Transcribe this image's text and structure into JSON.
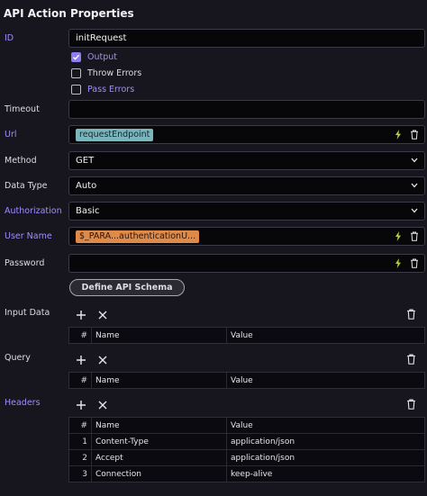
{
  "panel": {
    "title": "API Action Properties"
  },
  "id": {
    "label": "ID",
    "value": "initRequest"
  },
  "checkboxes": [
    {
      "label": "Output",
      "checked": true
    },
    {
      "label": "Throw Errors",
      "checked": false
    },
    {
      "label": "Pass Errors",
      "checked": false
    }
  ],
  "timeout": {
    "label": "Timeout",
    "value": ""
  },
  "url": {
    "label": "Url",
    "tag": "requestEndpoint"
  },
  "method": {
    "label": "Method",
    "value": "GET"
  },
  "data_type": {
    "label": "Data Type",
    "value": "Auto"
  },
  "authorization": {
    "label": "Authorization",
    "value": "Basic"
  },
  "user_name": {
    "label": "User Name",
    "tag": "$_PARA...authenticationU..."
  },
  "password": {
    "label": "Password",
    "value": ""
  },
  "define_schema": {
    "label": "Define API Schema"
  },
  "input_data": {
    "label": "Input Data",
    "columns": [
      "#",
      "Name",
      "Value"
    ],
    "rows": []
  },
  "query": {
    "label": "Query",
    "columns": [
      "#",
      "Name",
      "Value"
    ],
    "rows": []
  },
  "headers": {
    "label": "Headers",
    "columns": [
      "#",
      "Name",
      "Value"
    ],
    "rows": [
      {
        "num": "1",
        "name": "Content-Type",
        "value": "application/json"
      },
      {
        "num": "2",
        "name": "Accept",
        "value": "application/json"
      },
      {
        "num": "3",
        "name": "Connection",
        "value": "keep-alive"
      }
    ]
  },
  "colors": {
    "accent": "#8c7df0",
    "url_tag": "#7bb6bd",
    "user_tag": "#e08a4a",
    "bolt": "#b8d23a"
  }
}
